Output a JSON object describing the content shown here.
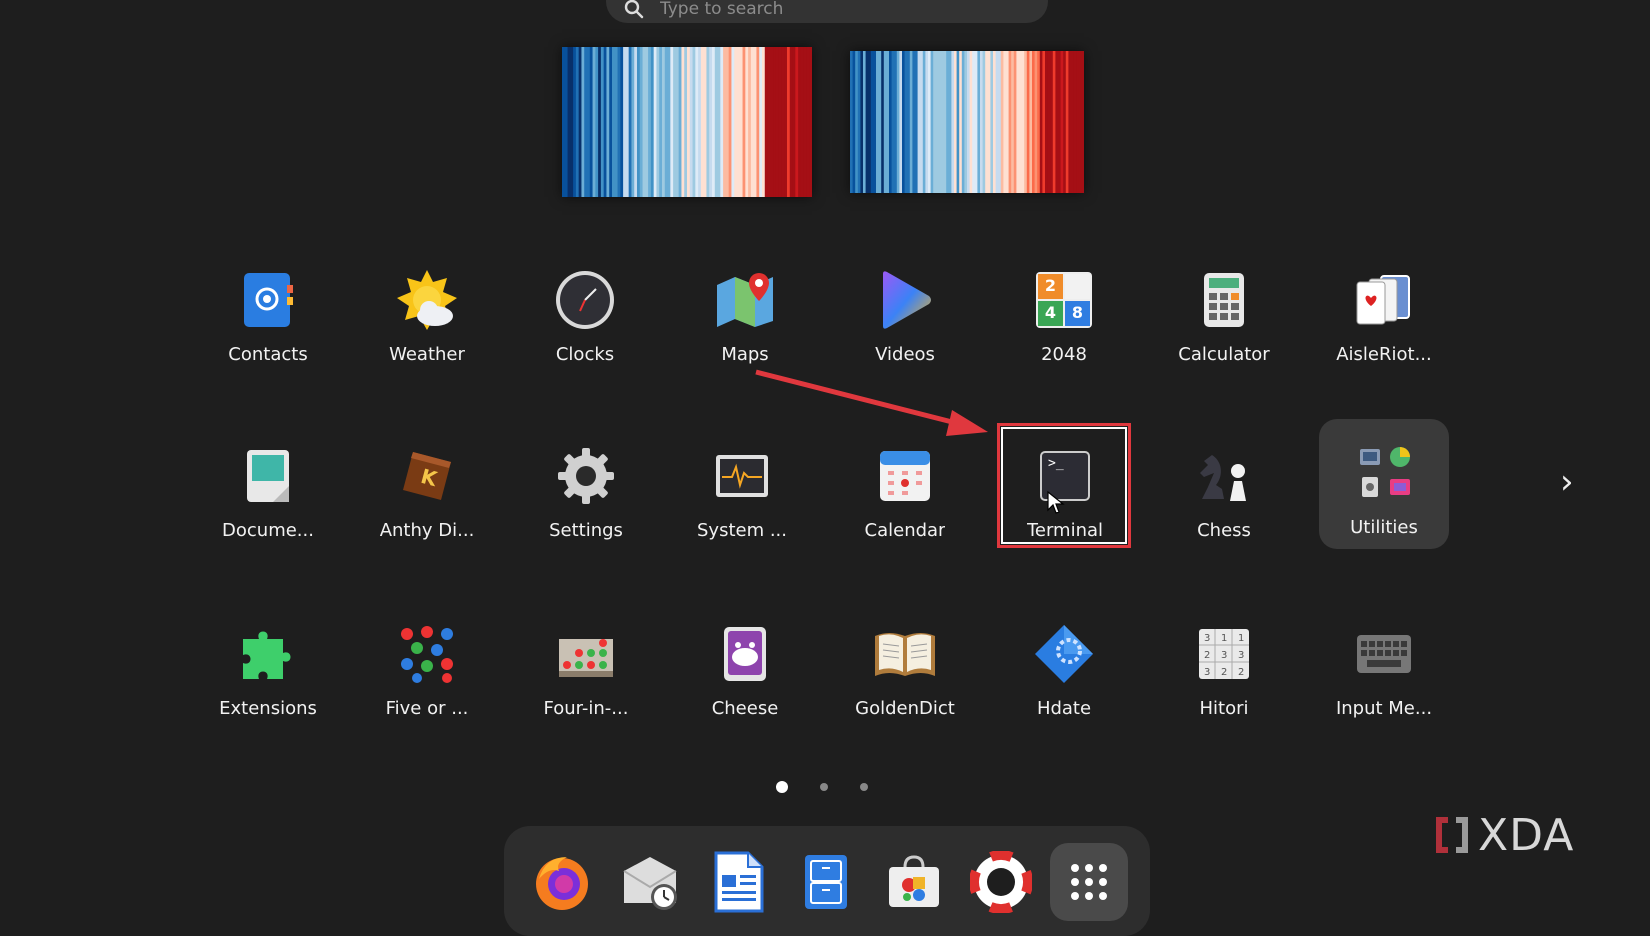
{
  "search": {
    "placeholder": "Type to search"
  },
  "apps": [
    {
      "label": "Contacts"
    },
    {
      "label": "Weather"
    },
    {
      "label": "Clocks"
    },
    {
      "label": "Maps"
    },
    {
      "label": "Videos"
    },
    {
      "label": "2048"
    },
    {
      "label": "Calculator"
    },
    {
      "label": "AisleRiot..."
    },
    {
      "label": "Docume..."
    },
    {
      "label": "Anthy Di..."
    },
    {
      "label": "Settings"
    },
    {
      "label": "System ..."
    },
    {
      "label": "Calendar"
    },
    {
      "label": "Terminal"
    },
    {
      "label": "Chess"
    },
    {
      "label": "Utilities"
    },
    {
      "label": "Extensions"
    },
    {
      "label": "Five or ..."
    },
    {
      "label": "Four-in-..."
    },
    {
      "label": "Cheese"
    },
    {
      "label": "GoldenDict"
    },
    {
      "label": "Hdate"
    },
    {
      "label": "Hitori"
    },
    {
      "label": "Input Me..."
    }
  ],
  "tile_2048": [
    "2",
    "4",
    "8"
  ],
  "terminal_prompt": ">_",
  "pagination": {
    "pages": 3,
    "current": 1
  },
  "dock": [
    "firefox-icon",
    "clock-mail-icon",
    "writer-icon",
    "files-icon",
    "software-icon",
    "help-icon",
    "app-grid-icon"
  ],
  "watermark": "XDA",
  "colors": {
    "highlight": "#e0383e",
    "arrow": "#e0383e",
    "background": "#1e1e1e"
  }
}
